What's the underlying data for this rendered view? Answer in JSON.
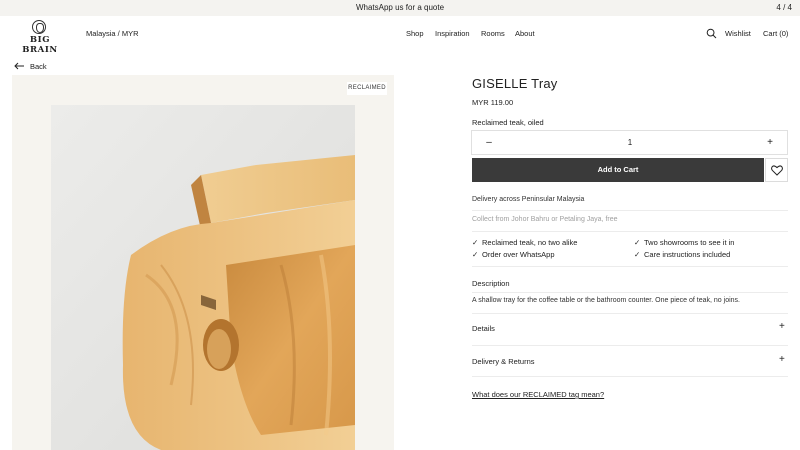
{
  "announcement": {
    "message": "WhatsApp us for a quote",
    "counter": "4 / 4"
  },
  "header": {
    "logo_text": "BIG BRAIN",
    "region": "Malaysia / MYR",
    "nav": [
      "Shop",
      "Inspiration",
      "Rooms",
      "About"
    ],
    "wishlist": "Wishlist",
    "cart": "Cart (0)"
  },
  "back_label": "Back",
  "gallery": {
    "badge": "RECLAIMED"
  },
  "product": {
    "title": "GISELLE Tray",
    "price": "MYR 119.00",
    "variant": "Reclaimed teak, oiled",
    "quantity": "1",
    "add_to_cart": "Add to Cart"
  },
  "delivery": {
    "line1": "Delivery across Peninsular Malaysia",
    "line2": "Collect from Johor Bahru or Petaling Jaya, free"
  },
  "features": [
    "Reclaimed teak, no two alike",
    "Two showrooms to see it in",
    "Order over WhatsApp",
    "Care instructions included"
  ],
  "accordion": {
    "description_label": "Description",
    "description_text": "A shallow tray for the coffee table or the bathroom counter. One piece of teak, no joins.",
    "details_label": "Details",
    "returns_label": "Delivery & Returns"
  },
  "tag_link": "What does our RECLAIMED tag mean?",
  "colors": {
    "button": "#3a3a3a",
    "gallery_bg": "#f6f4ef",
    "announce_bg": "#f4f3f0",
    "wood": "#e2b06a"
  }
}
